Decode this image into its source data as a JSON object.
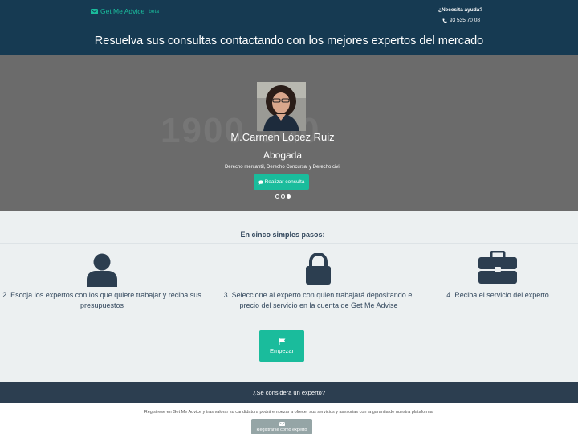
{
  "header": {
    "brand": "Get Me Advice",
    "brand_tag": "beta",
    "help_title": "¿Necesita ayuda?",
    "phone": "93 535 70 08",
    "headline": "Resuelva sus consultas contactando con los mejores expertos del mercado"
  },
  "hero": {
    "watermark": "1900 500",
    "expert_name": "M.Carmen López Ruiz",
    "expert_role": "Abogada",
    "expert_areas": "Derecho mercantil, Derecho Concursal y Derecho civil",
    "consult_button": "Realizar consulta",
    "carousel_active_index": 2,
    "carousel_count": 3
  },
  "steps": {
    "title": "En cinco simples pasos:",
    "items": [
      {
        "icon": "user-icon",
        "text": "2. Escoja los expertos con los que quiere trabajar y reciba sus presupuestos"
      },
      {
        "icon": "lock-icon",
        "text": "3. Seleccione al experto con quien trabajará depositando el precio del servicio en la cuenta de Get Me Advise"
      },
      {
        "icon": "briefcase-icon",
        "text": "4. Reciba el servicio del experto"
      }
    ],
    "start_button": "Empezar"
  },
  "expert_section": {
    "question": "¿Se considera un experto?",
    "description": "Registrese en Get Me Advice y tras valorar su candidatura podrá empezar a ofrecer sus servicios y asesorias con la garantia de nuestra plataforma.",
    "register_button": "Registrarse como experto"
  },
  "colors": {
    "header_bg": "#163a52",
    "accent": "#1abc9c",
    "hero_bg": "#6b6b6b",
    "dark_text": "#34495e",
    "band_bg": "#2c3e50"
  }
}
